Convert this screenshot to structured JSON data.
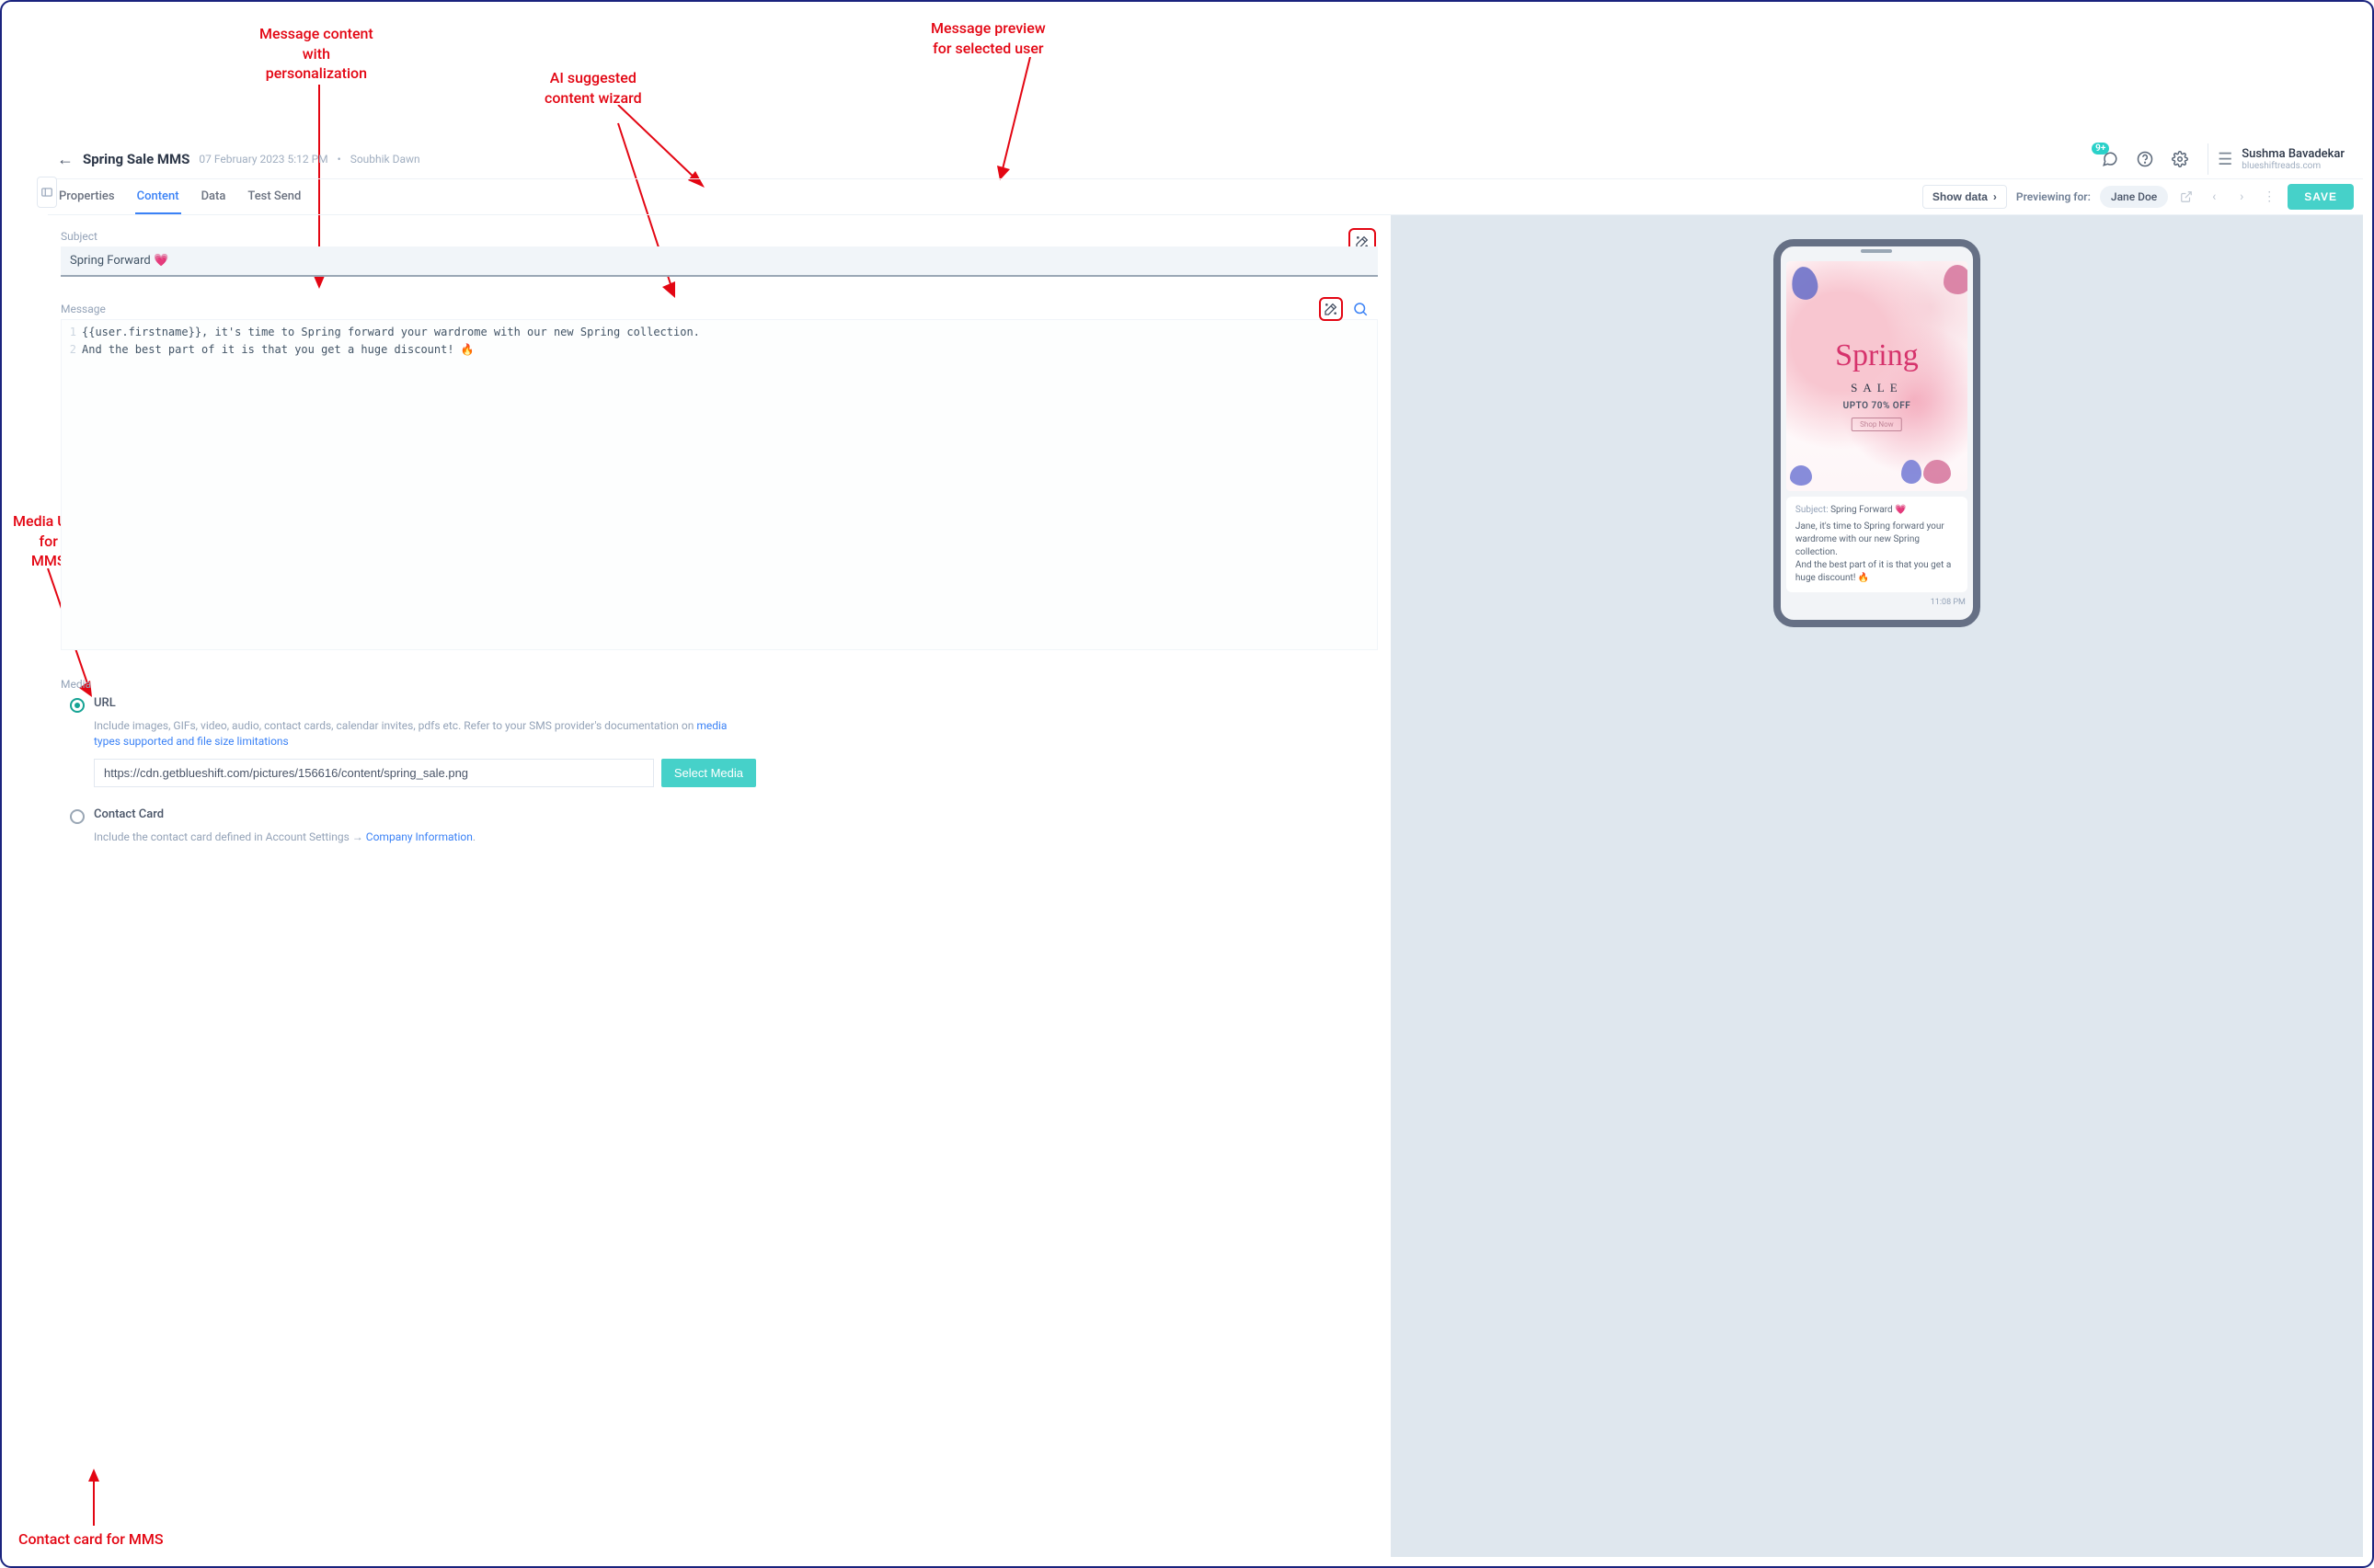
{
  "annotations": {
    "msg_content": "Message content\nwith\npersonalization",
    "ai_wizard": "AI suggested\ncontent wizard",
    "preview": "Message preview\nfor selected user",
    "media_url": "Media URL\nfor\nMMS",
    "contact_card": "Contact card for MMS"
  },
  "header": {
    "title": "Spring Sale MMS",
    "timestamp": "07 February 2023 5:12 PM",
    "separator": "•",
    "author": "Soubhik Dawn",
    "notif_badge": "9+",
    "user_name": "Sushma Bavadekar",
    "user_domain": "blueshiftreads.com"
  },
  "tabs": {
    "properties": "Properties",
    "content": "Content",
    "data": "Data",
    "test_send": "Test Send"
  },
  "toolbar": {
    "show_data": "Show data",
    "previewing_for": "Previewing for:",
    "preview_user": "Jane Doe",
    "save": "SAVE"
  },
  "subject": {
    "label": "Subject",
    "value": "Spring Forward 💗"
  },
  "message": {
    "label": "Message",
    "lines": {
      "l1_num": "1",
      "l1_text": "{{user.firstname}}, it's time to Spring forward your wardrome with our new Spring collection.",
      "l2_num": "2",
      "l2_text": "And the best part of it is that you get a huge discount! 🔥"
    }
  },
  "media": {
    "label": "Media",
    "url_label": "URL",
    "url_help_prefix": "Include images, GIFs, video, audio, contact cards, calendar invites, pdfs etc. Refer to your SMS provider's documentation on ",
    "url_help_link": "media types supported and file size limitations",
    "url_value": "https://cdn.getblueshift.com/pictures/156616/content/spring_sale.png",
    "select_btn": "Select Media",
    "contact_label": "Contact Card",
    "contact_help_prefix": "Include the contact card defined in Account Settings → ",
    "contact_help_link": "Company Information",
    "contact_help_suffix": "."
  },
  "preview": {
    "img_spring": "Spring",
    "img_sale": "SALE",
    "img_upto": "UPTO 70% OFF",
    "img_shop": "Shop Now",
    "subj_label": "Subject:",
    "subj_value": "Spring Forward 💗",
    "body1": "Jane, it's time to Spring forward your wardrome with our new Spring collection.",
    "body2": "And the best part of it is that you get a huge discount! 🔥",
    "time": "11:08 PM"
  }
}
